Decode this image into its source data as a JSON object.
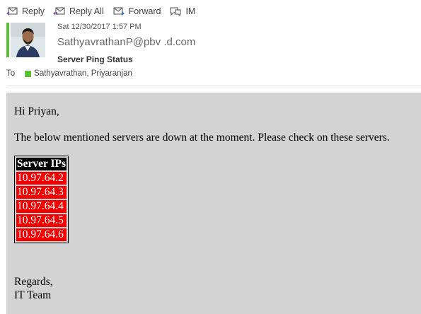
{
  "toolbar": {
    "reply": "Reply",
    "reply_all": "Reply All",
    "forward": "Forward",
    "im": "IM"
  },
  "header": {
    "date": "Sat 12/30/2017 1:57 PM",
    "from": "SathyavrathanP@pbv      .d.com",
    "subject": "Server Ping Status",
    "to_label": "To",
    "to_recipients": "Sathyavrathan, Priyaranjan"
  },
  "body": {
    "greeting": "Hi Priyan,",
    "message": "The below mentioned servers are down at the moment. Please check on these servers.",
    "table_header": "Server IPs",
    "servers": [
      "10.97.64.2",
      "10.97.64.3",
      "10.97.64.4",
      "10.97.64.5",
      "10.97.64.6"
    ],
    "closing": "Regards,",
    "signature": "IT Team"
  },
  "colors": {
    "accent": "#5bc236",
    "presence": "#5bc236",
    "body_bg": "#d3d3d3",
    "server_cell": "#f20000",
    "header_cell": "#000000"
  }
}
